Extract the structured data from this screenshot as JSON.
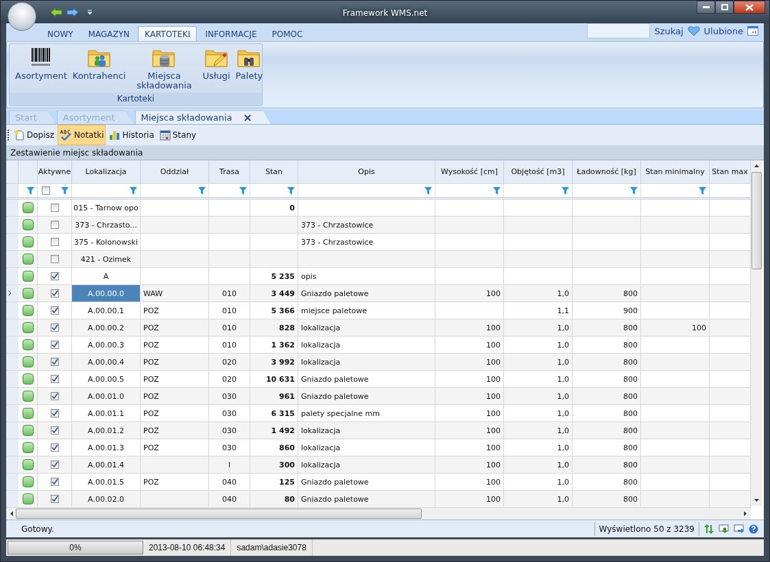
{
  "window": {
    "title": "Framework WMS.net"
  },
  "ribbon_tabs": [
    {
      "label": "NOWY",
      "selected": false
    },
    {
      "label": "MAGAZYN",
      "selected": false
    },
    {
      "label": "KARTOTEKI",
      "selected": true
    },
    {
      "label": "INFORMACJE",
      "selected": false
    },
    {
      "label": "POMOC",
      "selected": false
    }
  ],
  "search_button": "Szukaj",
  "favorites_button": "Ulubione",
  "ribbon_group": {
    "title": "Kartoteki",
    "items": [
      {
        "kind": "barcode",
        "label": "Asortyment"
      },
      {
        "kind": "people",
        "label": "Kontrahenci"
      },
      {
        "kind": "database",
        "label": "Miejsca składowania"
      },
      {
        "kind": "pencil",
        "label": "Usługi"
      },
      {
        "kind": "binoculars",
        "label": "Palety"
      }
    ]
  },
  "doc_tabs": [
    {
      "label": "Start",
      "selected": false,
      "closable": false
    },
    {
      "label": "Asortyment",
      "selected": false,
      "closable": false
    },
    {
      "label": "Miejsca składowania",
      "selected": true,
      "closable": true,
      "close": "×"
    }
  ],
  "toolbar": [
    {
      "kind": "new",
      "label": "Dopisz",
      "selected": false
    },
    {
      "kind": "spell",
      "label": "Notatki",
      "selected": true
    },
    {
      "kind": "chart",
      "label": "Historia",
      "selected": false
    },
    {
      "kind": "calendar",
      "label": "Stany",
      "selected": false
    }
  ],
  "grid": {
    "caption": "Zestawienie miejsc składowania",
    "active_column": {
      "label": "Aktywne",
      "filter_checked": false
    },
    "columns": [
      "Lokalizacja",
      "Oddział",
      "Trasa",
      "Stan",
      "Opis",
      "Wysokość [cm]",
      "Objętość [m3]",
      "Ładowność [kg]",
      "Stan minimalny",
      "Stan max"
    ],
    "rows": [
      {
        "selected": false,
        "active": false,
        "cells": [
          "015 - Tarnow opo",
          "",
          "",
          "0",
          "",
          "",
          "",
          "",
          "",
          ""
        ]
      },
      {
        "selected": false,
        "active": false,
        "cells": [
          "373 - Chrzasto...",
          "",
          "",
          "",
          "373 - Chrzastowice",
          "",
          "",
          "",
          "",
          ""
        ]
      },
      {
        "selected": false,
        "active": false,
        "cells": [
          "375 - Kolonowski",
          "",
          "",
          "",
          "373 - Chrzastowice",
          "",
          "",
          "",
          "",
          ""
        ]
      },
      {
        "selected": false,
        "active": false,
        "cells": [
          "421 - Ozimek",
          "",
          "",
          "",
          "",
          "",
          "",
          "",
          "",
          ""
        ]
      },
      {
        "selected": false,
        "active": true,
        "cells": [
          "A",
          "",
          "",
          "5 235",
          "opis",
          "",
          "",
          "",
          "",
          ""
        ]
      },
      {
        "selected": true,
        "active": true,
        "cells": [
          "A.00.00.0",
          "WAW",
          "010",
          "3 449",
          "Gniazdo paletowe",
          "100",
          "1,0",
          "800",
          "",
          ""
        ]
      },
      {
        "selected": false,
        "active": true,
        "cells": [
          "A.00.00.1",
          "POZ",
          "010",
          "5 366",
          "miejsce paletowe",
          "",
          "1,1",
          "900",
          "",
          ""
        ]
      },
      {
        "selected": false,
        "active": true,
        "cells": [
          "A.00.00.2",
          "POZ",
          "010",
          "828",
          "lokalizacja",
          "100",
          "1,0",
          "800",
          "100",
          ""
        ]
      },
      {
        "selected": false,
        "active": true,
        "cells": [
          "A.00.00.3",
          "POZ",
          "010",
          "1 362",
          "lokalizacja",
          "100",
          "1,0",
          "800",
          "",
          ""
        ]
      },
      {
        "selected": false,
        "active": true,
        "cells": [
          "A.00.00.4",
          "POZ",
          "020",
          "3 992",
          "lokalizacja",
          "100",
          "1,0",
          "800",
          "",
          ""
        ]
      },
      {
        "selected": false,
        "active": true,
        "cells": [
          "A.00.00.5",
          "POZ",
          "020",
          "10 631",
          "Gniazdo paletowe",
          "100",
          "1,0",
          "800",
          "",
          ""
        ]
      },
      {
        "selected": false,
        "active": true,
        "cells": [
          "A.00.01.0",
          "POZ",
          "030",
          "961",
          "Gniazdo paletowe",
          "100",
          "1,0",
          "800",
          "",
          ""
        ]
      },
      {
        "selected": false,
        "active": true,
        "cells": [
          "A.00.01.1",
          "POZ",
          "030",
          "6 315",
          "palety specjalne mm",
          "100",
          "1,0",
          "800",
          "",
          ""
        ]
      },
      {
        "selected": false,
        "active": true,
        "cells": [
          "A.00.01.2",
          "POZ",
          "030",
          "1 492",
          "lokalizacja",
          "100",
          "1,0",
          "800",
          "",
          ""
        ]
      },
      {
        "selected": false,
        "active": true,
        "cells": [
          "A.00.01.3",
          "POZ",
          "030",
          "860",
          "lokalizacja",
          "100",
          "1,0",
          "800",
          "",
          ""
        ]
      },
      {
        "selected": false,
        "active": true,
        "cells": [
          "A.00.01.4",
          "",
          "l",
          "300",
          "lokalizacja",
          "100",
          "1,0",
          "800",
          "",
          ""
        ]
      },
      {
        "selected": false,
        "active": true,
        "cells": [
          "A.00.01.5",
          "POZ",
          "040",
          "125",
          "Gniazdo paletowe",
          "100",
          "1,0",
          "800",
          "",
          ""
        ]
      },
      {
        "selected": false,
        "active": true,
        "cells": [
          "A.00.02.0",
          "",
          "040",
          "80",
          "Gniazdo paletowe",
          "100",
          "1,0",
          "800",
          "",
          ""
        ]
      }
    ]
  },
  "status": {
    "message": "Gotowy.",
    "count": "Wyświetlono 50 z 3239"
  },
  "bottom_bar": {
    "progress": {
      "level": 0,
      "text": "0%"
    },
    "datetime": "2013-08-10 06:48:34",
    "user": "sadam\\adasie3078"
  }
}
